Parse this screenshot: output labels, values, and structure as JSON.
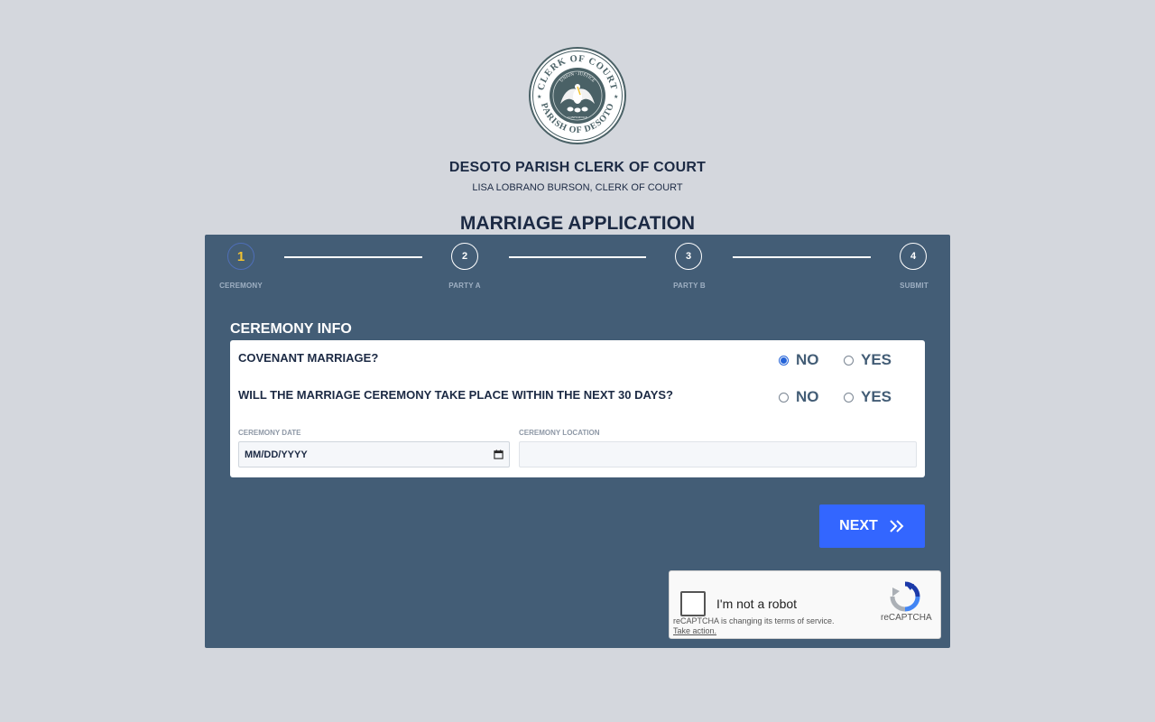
{
  "seal": {
    "top_text": "CLERK OF COURT",
    "bottom_text": "PARISH OF DESOTO",
    "motto_top": "UNION · JUSTICE",
    "motto_bottom": "CONFIDENCE"
  },
  "header": {
    "org_name": "DESOTO PARISH CLERK OF COURT",
    "org_subtitle": "LISA LOBRANO BURSON, CLERK OF COURT",
    "page_title": "MARRIAGE APPLICATION"
  },
  "stepper": {
    "steps": [
      {
        "number": "1",
        "label": "CEREMONY",
        "active": true
      },
      {
        "number": "2",
        "label": "PARTY A",
        "active": false
      },
      {
        "number": "3",
        "label": "PARTY B",
        "active": false
      },
      {
        "number": "4",
        "label": "SUBMIT",
        "active": false
      }
    ]
  },
  "form": {
    "section_title": "CEREMONY INFO",
    "questions": [
      {
        "text": "COVENANT MARRIAGE?",
        "options": [
          {
            "label": "NO",
            "checked": true
          },
          {
            "label": "YES",
            "checked": false
          }
        ]
      },
      {
        "text": "WILL THE MARRIAGE CEREMONY TAKE PLACE WITHIN THE NEXT 30 DAYS?",
        "options": [
          {
            "label": "NO",
            "checked": false
          },
          {
            "label": "YES",
            "checked": false
          }
        ]
      }
    ],
    "ceremony_date": {
      "label": "CEREMONY DATE",
      "placeholder": "MM/DD/YYYY"
    },
    "ceremony_location": {
      "label": "CEREMONY LOCATION",
      "value": ""
    },
    "next_button": "NEXT"
  },
  "captcha": {
    "label": "I'm not a robot",
    "notice": "reCAPTCHA is changing its terms of service.",
    "notice_link": "Take action.",
    "brand": "reCAPTCHA"
  },
  "colors": {
    "background": "#d4d7dd",
    "panel": "#435d76",
    "primary_button": "#3366ff",
    "active_step_number": "#f1c232",
    "heading_text": "#1c2a44"
  }
}
